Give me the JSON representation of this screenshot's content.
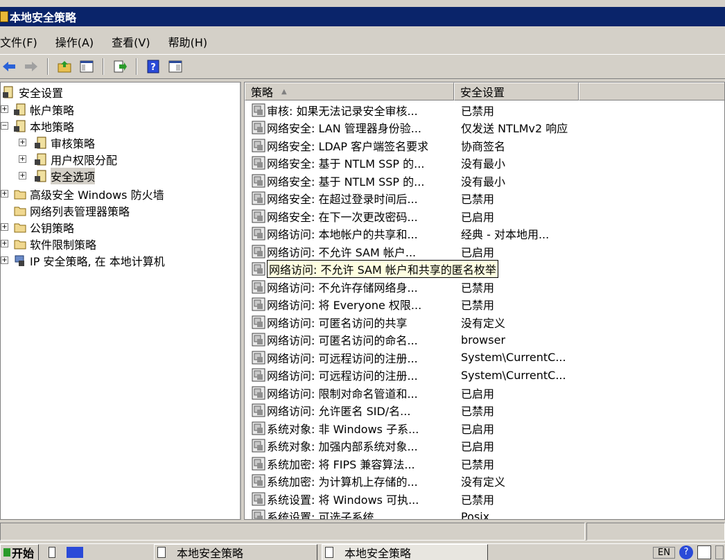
{
  "window": {
    "title": "本地安全策略"
  },
  "menu": [
    {
      "label": "文件(F)"
    },
    {
      "label": "操作(A)"
    },
    {
      "label": "查看(V)"
    },
    {
      "label": "帮助(H)"
    }
  ],
  "tree": {
    "root": "安全设置",
    "items": [
      {
        "label": "帐户策略"
      },
      {
        "label": "本地策略"
      },
      {
        "label": "审核策略"
      },
      {
        "label": "用户权限分配"
      },
      {
        "label": "安全选项"
      },
      {
        "label": "高级安全 Windows 防火墙"
      },
      {
        "label": "网络列表管理器策略"
      },
      {
        "label": "公钥策略"
      },
      {
        "label": "软件限制策略"
      },
      {
        "label": "IP 安全策略, 在 本地计算机"
      }
    ]
  },
  "list": {
    "headers": {
      "policy": "策略",
      "setting": "安全设置"
    },
    "rows": [
      {
        "policy": "审核: 如果无法记录安全审核...",
        "setting": "已禁用"
      },
      {
        "policy": "网络安全: LAN 管理器身份验...",
        "setting": "仅发送 NTLMv2 响应"
      },
      {
        "policy": "网络安全: LDAP 客户端签名要求",
        "setting": "协商签名"
      },
      {
        "policy": "网络安全: 基于 NTLM SSP 的...",
        "setting": "没有最小"
      },
      {
        "policy": "网络安全: 基于 NTLM SSP 的...",
        "setting": "没有最小"
      },
      {
        "policy": "网络安全: 在超过登录时间后...",
        "setting": "已禁用"
      },
      {
        "policy": "网络安全: 在下一次更改密码...",
        "setting": "已启用"
      },
      {
        "policy": "网络访问: 本地帐户的共享和...",
        "setting": "经典 - 对本地用..."
      },
      {
        "policy": "网络访问: 不允许 SAM 帐户...",
        "setting": "已启用"
      },
      {
        "policy": "网络访问: 不允许 SAM 帐户和共享的匿名枚举",
        "setting": ""
      },
      {
        "policy": "网络访问: 不允许存储网络身...",
        "setting": "已禁用"
      },
      {
        "policy": "网络访问: 将 Everyone 权限...",
        "setting": "已禁用"
      },
      {
        "policy": "网络访问: 可匿名访问的共享",
        "setting": "没有定义"
      },
      {
        "policy": "网络访问: 可匿名访问的命名...",
        "setting": "browser"
      },
      {
        "policy": "网络访问: 可远程访问的注册...",
        "setting": "System\\CurrentC..."
      },
      {
        "policy": "网络访问: 可远程访问的注册...",
        "setting": "System\\CurrentC..."
      },
      {
        "policy": "网络访问: 限制对命名管道和...",
        "setting": "已启用"
      },
      {
        "policy": "网络访问: 允许匿名 SID/名...",
        "setting": "已禁用"
      },
      {
        "policy": "系统对象: 非 Windows 子系...",
        "setting": "已启用"
      },
      {
        "policy": "系统对象: 加强内部系统对象...",
        "setting": "已启用"
      },
      {
        "policy": "系统加密: 将 FIPS 兼容算法...",
        "setting": "已禁用"
      },
      {
        "policy": "系统加密: 为计算机上存储的...",
        "setting": "没有定义"
      },
      {
        "policy": "系统设置: 将 Windows 可执...",
        "setting": "已禁用"
      },
      {
        "policy": "系统设置: 可选子系统",
        "setting": "Posix"
      }
    ]
  },
  "taskbar": {
    "start": "开始",
    "task1": "本地安全策略",
    "task2": "本地安全策略",
    "lang": "EN"
  },
  "colors": {
    "titlebar": "#0a246a",
    "tooltip": "#ffffe1",
    "window": "#d4d0c8"
  }
}
